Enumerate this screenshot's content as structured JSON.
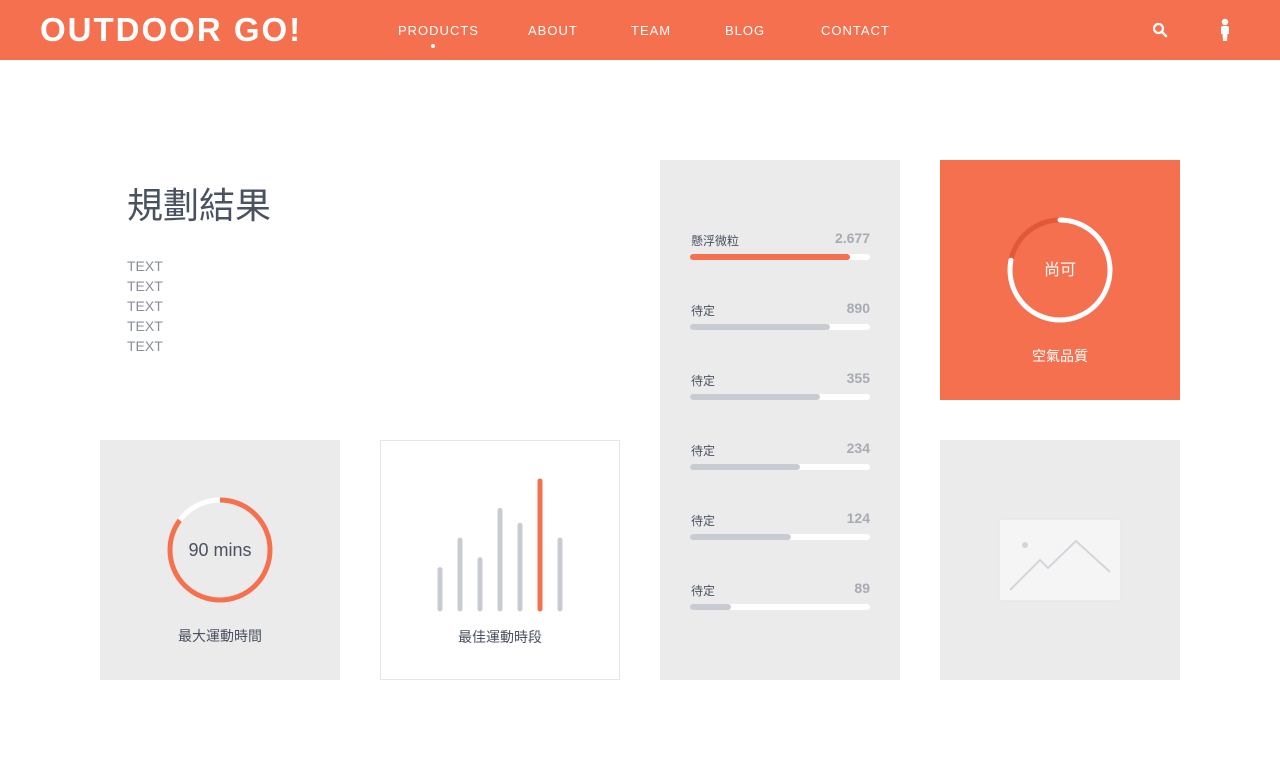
{
  "header": {
    "logo": "OUTDOOR GO!",
    "nav": [
      "PRODUCTS",
      "ABOUT",
      "TEAM",
      "BLOG",
      "CONTACT"
    ],
    "active_nav": "PRODUCTS",
    "icons": [
      "search-icon",
      "user-icon"
    ]
  },
  "main": {
    "title": "規劃結果",
    "text_lines": [
      "TEXT",
      "TEXT",
      "TEXT",
      "TEXT",
      "TEXT"
    ]
  },
  "exercise_time": {
    "value_text": "90 mins",
    "label": "最大運動時間",
    "progress": 0.85
  },
  "best_period": {
    "label": "最佳運動時段",
    "bar_values": [
      2,
      3.5,
      2.5,
      5,
      4.25,
      6.5,
      3.5
    ],
    "highlight_index": 5
  },
  "stats": [
    {
      "name": "懸浮微粒",
      "value": "2.677",
      "fraction": 0.89,
      "highlight": true
    },
    {
      "name": "待定",
      "value": "890",
      "fraction": 0.78,
      "highlight": false
    },
    {
      "name": "待定",
      "value": "355",
      "fraction": 0.72,
      "highlight": false
    },
    {
      "name": "待定",
      "value": "234",
      "fraction": 0.61,
      "highlight": false
    },
    {
      "name": "待定",
      "value": "124",
      "fraction": 0.56,
      "highlight": false
    },
    {
      "name": "待定",
      "value": "89",
      "fraction": 0.23,
      "highlight": false
    }
  ],
  "air_quality": {
    "status": "尚可",
    "label": "空氣品質",
    "progress": 0.78
  },
  "placeholder": {
    "icon": "image-placeholder-icon"
  },
  "colors": {
    "accent": "#F5704E",
    "card_gray": "#EBEBEB",
    "text_dark": "#4A5160",
    "bar_gray": "#C8CCD2"
  }
}
